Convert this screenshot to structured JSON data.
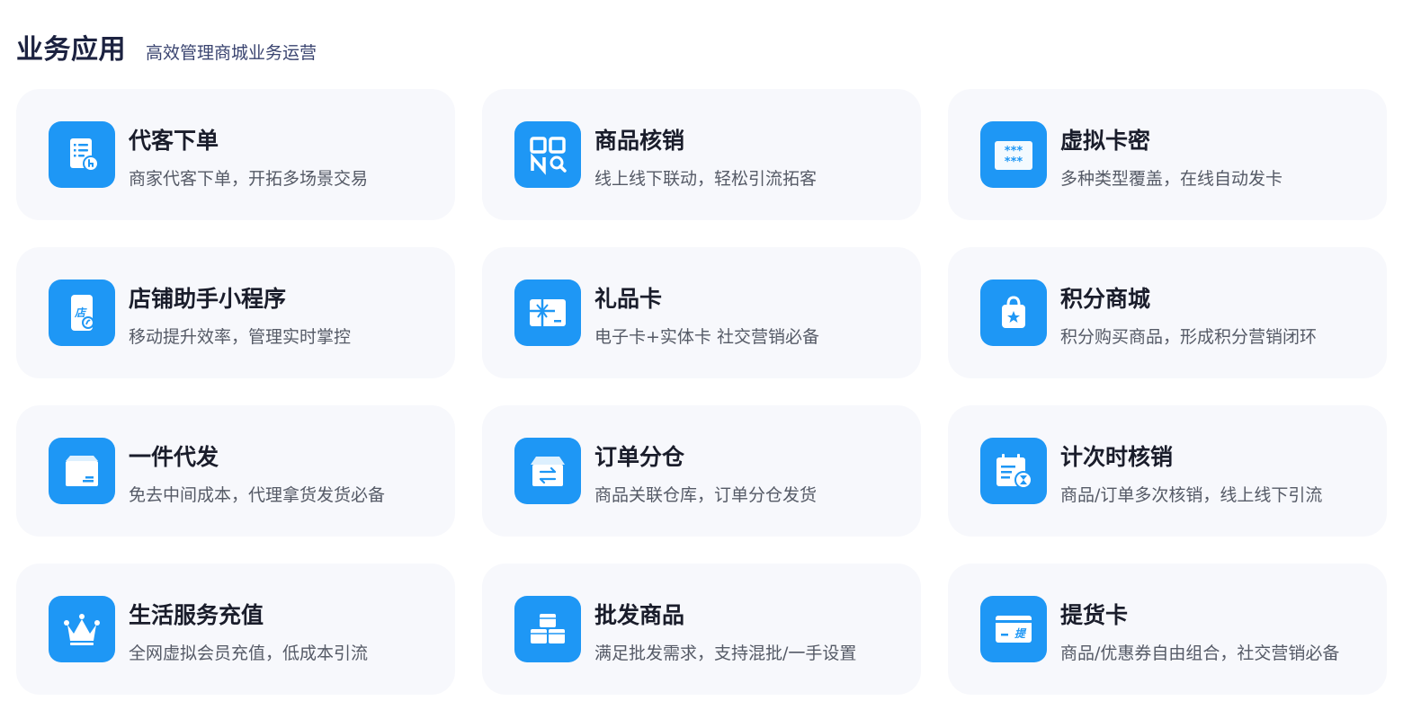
{
  "header": {
    "title": "业务应用",
    "subtitle": "高效管理商城业务运营"
  },
  "colors": {
    "icon_bg": "#1e97f5",
    "card_bg": "#f7f8fc",
    "title": "#1a1d2b",
    "desc": "#555a66"
  },
  "cards": [
    {
      "title": "代客下单",
      "desc": "商家代客下单，开拓多场景交易",
      "icon": "order-list-icon"
    },
    {
      "title": "商品核销",
      "desc": "线上线下联动，轻松引流拓客",
      "icon": "qr-scan-icon"
    },
    {
      "title": "虚拟卡密",
      "desc": "多种类型覆盖，在线自动发卡",
      "icon": "card-password-icon"
    },
    {
      "title": "店铺助手小程序",
      "desc": "移动提升效率，管理实时掌控",
      "icon": "store-phone-icon"
    },
    {
      "title": "礼品卡",
      "desc": "电子卡+实体卡 社交营销必备",
      "icon": "gift-card-icon"
    },
    {
      "title": "积分商城",
      "desc": "积分购买商品，形成积分营销闭环",
      "icon": "shopping-bag-icon"
    },
    {
      "title": "一件代发",
      "desc": "免去中间成本，代理拿货发货必备",
      "icon": "package-box-icon"
    },
    {
      "title": "订单分仓",
      "desc": "商品关联仓库，订单分仓发货",
      "icon": "warehouse-transfer-icon"
    },
    {
      "title": "计次时核销",
      "desc": "商品/订单多次核销，线上线下引流",
      "icon": "calendar-timer-icon"
    },
    {
      "title": "生活服务充值",
      "desc": "全网虚拟会员充值，低成本引流",
      "icon": "crown-icon"
    },
    {
      "title": "批发商品",
      "desc": "满足批发需求，支持混批/一手设置",
      "icon": "stacked-boxes-icon"
    },
    {
      "title": "提货卡",
      "desc": "商品/优惠券自由组合，社交营销必备",
      "icon": "pickup-card-icon"
    }
  ]
}
